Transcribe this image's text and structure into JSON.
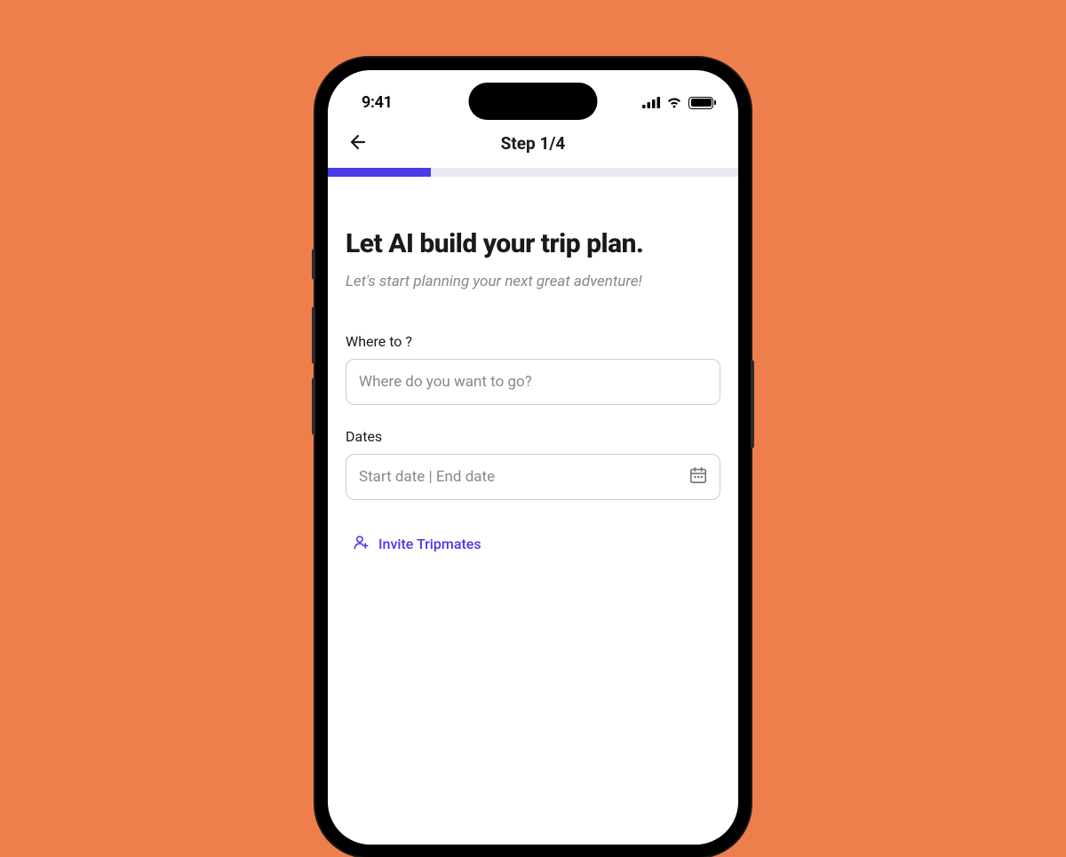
{
  "statusBar": {
    "time": "9:41"
  },
  "nav": {
    "title": "Step 1/4"
  },
  "progress": {
    "current": 1,
    "total": 4
  },
  "content": {
    "heading": "Let AI build your trip plan.",
    "subheading": "Let's start planning your next great adventure!"
  },
  "fields": {
    "destination": {
      "label": "Where to ?",
      "placeholder": "Where do you want to go?",
      "value": ""
    },
    "dates": {
      "label": "Dates",
      "placeholder": "Start date | End date",
      "value": ""
    }
  },
  "invite": {
    "label": "Invite Tripmates"
  },
  "colors": {
    "background": "#ef7e4d",
    "accent": "#4a39e8"
  }
}
